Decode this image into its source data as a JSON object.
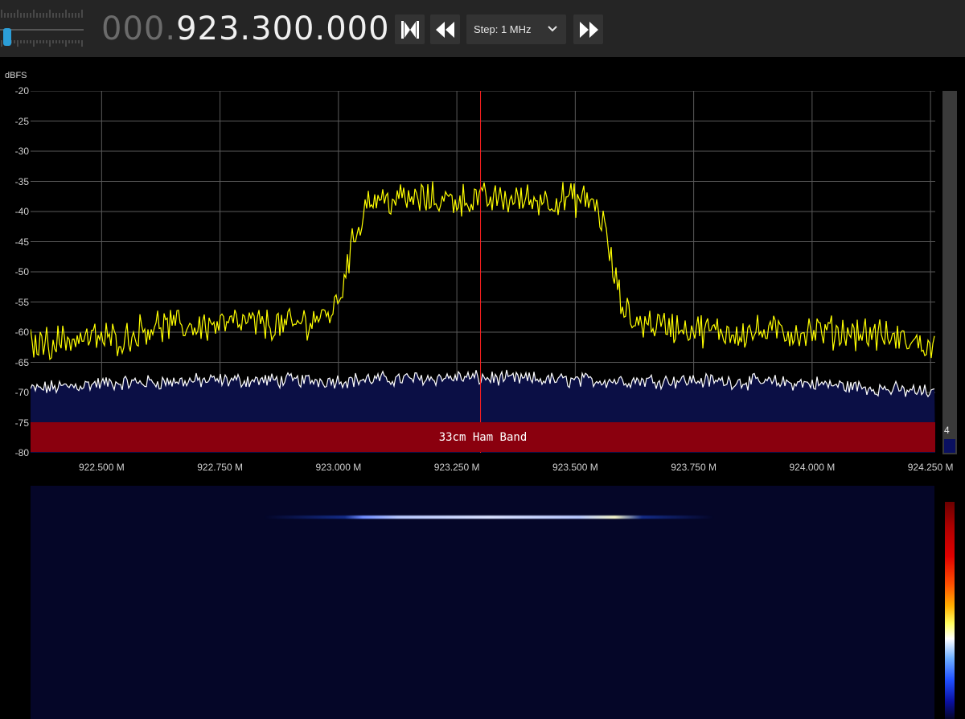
{
  "toolbar": {
    "frequency_dim": "000.",
    "frequency_bright": "923.300.000",
    "step_label": "Step: 1 MHz",
    "buttons": [
      "center-tuning",
      "step-down",
      "step-up"
    ]
  },
  "spectrum": {
    "unit": "dBFS",
    "band_label": "33cm Ham Band",
    "averaging_value": "4",
    "colors": {
      "signal": "#ffff00",
      "noise_floor": "#ffffff",
      "floor_fill": "#0b0f45",
      "center_line": "#ff2020",
      "band": "#8a000e"
    }
  },
  "chart_data": {
    "type": "line",
    "xlabel": "",
    "ylabel": "dBFS",
    "xlim": [
      922.35,
      924.26
    ],
    "ylim": [
      -80,
      -20
    ],
    "y_ticks": [
      "-20",
      "-25",
      "-30",
      "-35",
      "-40",
      "-45",
      "-50",
      "-55",
      "-60",
      "-65",
      "-70",
      "-75",
      "-80"
    ],
    "x_ticks": [
      "922.500 M",
      "922.750 M",
      "923.000 M",
      "923.250 M",
      "923.500 M",
      "923.750 M",
      "924.000 M",
      "924.250 M"
    ],
    "x_tick_values": [
      922.5,
      922.75,
      923.0,
      923.25,
      923.5,
      923.75,
      924.0,
      924.25
    ],
    "center_frequency": 923.3,
    "grid": true,
    "series": [
      {
        "x": [
          922.35,
          922.45,
          922.55,
          922.6,
          922.7,
          922.8,
          922.9,
          922.98,
          923.0,
          923.02,
          923.04,
          923.06,
          923.1,
          923.2,
          923.3,
          923.4,
          923.5,
          923.54,
          923.56,
          923.58,
          923.6,
          923.62,
          923.7,
          923.8,
          923.9,
          924.0,
          924.1,
          924.2,
          924.26
        ],
        "y": [
          -62,
          -61,
          -61,
          -59,
          -59,
          -58.5,
          -59,
          -57,
          -55,
          -48,
          -43,
          -38,
          -38,
          -38,
          -38,
          -38,
          -38,
          -38.5,
          -42,
          -50,
          -56,
          -58,
          -59,
          -60,
          -60,
          -60,
          -60,
          -61.5,
          -62.5
        ]
      },
      {
        "x": [
          922.35,
          922.5,
          922.75,
          923.0,
          923.25,
          923.5,
          923.75,
          924.0,
          924.25
        ],
        "y": [
          -69.5,
          -68.5,
          -68,
          -68,
          -67.5,
          -68,
          -68,
          -68.5,
          -70
        ]
      }
    ]
  },
  "waterfall": {
    "colorbar": "heat"
  }
}
